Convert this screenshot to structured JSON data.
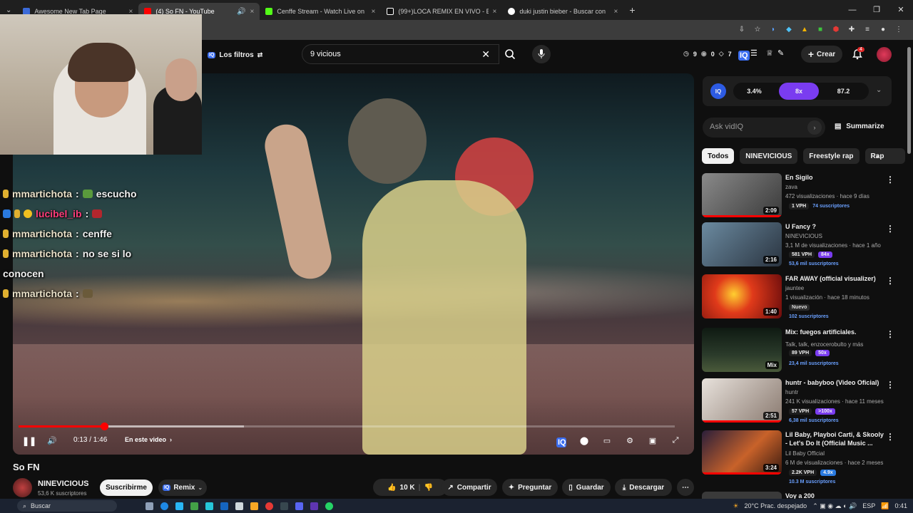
{
  "browser": {
    "tabs": [
      {
        "title": "Awesome New Tab Page",
        "favicon_color": "#3b6ad8"
      },
      {
        "title": "(4) So FN - YouTube",
        "favicon_color": "#ff0000",
        "active": true
      },
      {
        "title": "Cenffe Stream - Watch Live on",
        "favicon_color": "#53fc18"
      },
      {
        "title": "(99+)LOCA REMIX EN VIVO - Bi",
        "favicon_color": "#ffffff"
      },
      {
        "title": "duki justin bieber - Buscar con",
        "favicon_color": "#ffffff"
      }
    ],
    "tab_close": "×",
    "new_tab": "+"
  },
  "youtube": {
    "filters_label": "Los filtros",
    "search_value": "9 vicious",
    "stats": {
      "a": "9",
      "b": "0",
      "c": "7"
    },
    "create_label": "Crear",
    "notif_count": "4"
  },
  "player": {
    "time": "0:13 / 1:46",
    "chapter": "En este video",
    "progress_fraction": 0.13
  },
  "chat": [
    {
      "user": "mmartichota",
      "msg": "escucho",
      "user_color": "#e9e0c8"
    },
    {
      "user": "lucibel_ib",
      "msg": "",
      "user_color": "#ff3c7a"
    },
    {
      "user": "mmartichota",
      "msg": "cenffe",
      "user_color": "#e9e0c8"
    },
    {
      "user": "mmartichota",
      "msg": "no se si lo",
      "user_color": "#e9e0c8"
    },
    {
      "user": "",
      "msg": "conocen",
      "user_color": "#e9e0c8"
    },
    {
      "user": "mmartichota",
      "msg": "",
      "user_color": "#e9e0c8"
    }
  ],
  "video": {
    "title": "So FN",
    "channel": "NINEVICIOUS",
    "subs": "53,6 K suscriptores",
    "subscribe": "Suscribirme",
    "remix": "Remix",
    "likes": "10 K",
    "share": "Compartir",
    "ask": "Preguntar",
    "save": "Guardar",
    "download": "Descargar"
  },
  "vidiq": {
    "badge": "IQ",
    "val1": "3.4%",
    "val2": "8x",
    "val3": "87.2",
    "ask_placeholder": "Ask vidIQ",
    "summarize": "Summarize"
  },
  "chips": [
    "Todos",
    "NINEVICIOUS",
    "Freestyle rap",
    "Rap"
  ],
  "related": [
    {
      "title": "En Sigilo",
      "channel": "zava",
      "meta": "472 visualizaciones · hace 9 días",
      "vph": "1 VPH",
      "x": "",
      "subs": "74 suscriptores",
      "duration": "2:09",
      "thumb": "#6a6a6a",
      "new": ""
    },
    {
      "title": "U Fancy ?",
      "channel": "NINEVICIOUS",
      "meta": "3,1 M de visualizaciones · hace 1 año",
      "vph": "581 VPH",
      "x": "84x",
      "subs": "53,6 mil suscriptores",
      "duration": "2:16",
      "thumb": "#3d4c5a",
      "new": ""
    },
    {
      "title": "FAR AWAY (official visualizer)",
      "channel": "jauntee",
      "meta": "1 visualización · hace 18 minutos",
      "vph": "",
      "x": "",
      "subs": "102 suscriptores",
      "duration": "1:40",
      "thumb": "#c81e16",
      "new": "Nuevo"
    },
    {
      "title": "Mix: fuegos artificiales.",
      "channel": "Talk, talk, enzocerobulto y más",
      "meta": "",
      "vph": "89 VPH",
      "x": "50x",
      "subs": "23,4 mil suscriptores",
      "duration": "Mix",
      "thumb": "#1c2a1e",
      "new": ""
    },
    {
      "title": "huntr - babyboo (Video Oficial)",
      "channel": "huntr",
      "meta": "241 K visualizaciones · hace 11 meses",
      "vph": "57 VPH",
      "x": ">100x",
      "subs": "6,38 mil suscriptores",
      "duration": "2:51",
      "thumb": "#d9d4cf",
      "new": ""
    },
    {
      "title": "Lil Baby, Playboi Carti, & Skooly - Let's Do It (Official Music ...",
      "channel": "Lil Baby Official",
      "meta": "6 M de visualizaciones · hace 2 meses",
      "vph": "2.2K VPH",
      "x": "4.9x",
      "subs": "10.3 M suscriptores",
      "duration": "3:24",
      "thumb": "#6a3a26",
      "new": ""
    },
    {
      "title": "Voy a 200",
      "channel": "",
      "meta": "",
      "vph": "",
      "x": "",
      "subs": "",
      "duration": "",
      "thumb": "#3a3a3a",
      "new": ""
    }
  ],
  "taskbar": {
    "search": "Buscar",
    "weather": "20°C  Prac. despejado",
    "lang": "ESP",
    "time": "0:41"
  },
  "colors": {
    "accent": "#ff0000",
    "vidiq_purple": "#7a3cf0",
    "vidiq_blue": "#2d5be3"
  }
}
